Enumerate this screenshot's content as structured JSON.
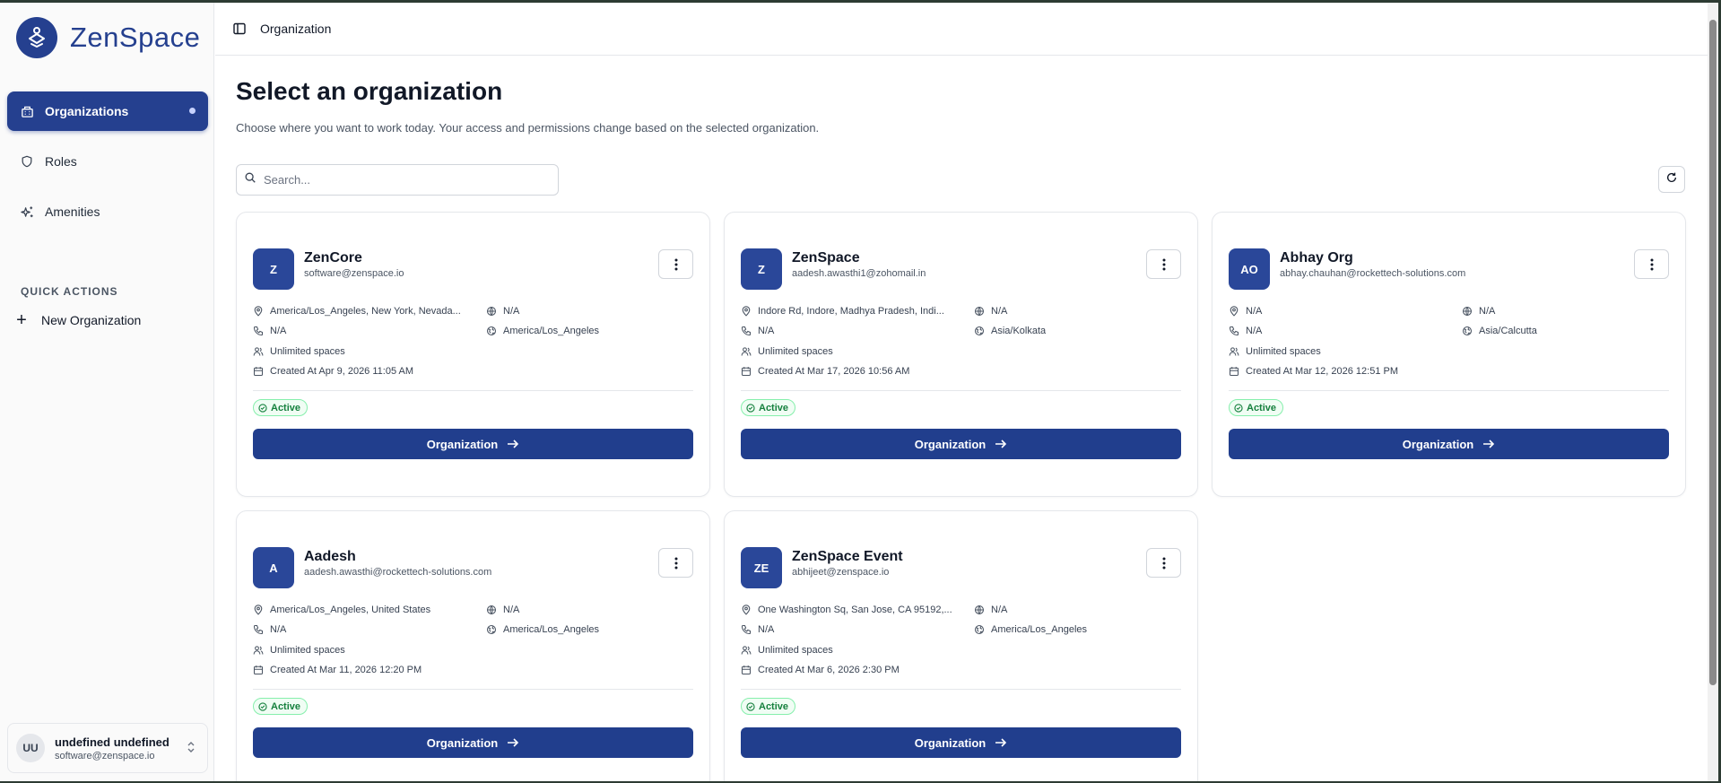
{
  "app": {
    "name": "ZenSpace"
  },
  "colors": {
    "brand": "#25408f",
    "active_green": "#15803d"
  },
  "sidebar": {
    "items": [
      {
        "label": "Organizations",
        "icon": "building-icon",
        "active": true
      },
      {
        "label": "Roles",
        "icon": "shield-icon",
        "active": false
      },
      {
        "label": "Amenities",
        "icon": "sparkles-icon",
        "active": false
      }
    ],
    "quick_actions_title": "QUICK ACTIONS",
    "quick_actions": [
      {
        "label": "New Organization",
        "icon": "plus-icon"
      }
    ],
    "user": {
      "initials": "UU",
      "name": "undefined undefined",
      "email": "software@zenspace.io"
    }
  },
  "header": {
    "breadcrumb": "Organization"
  },
  "main": {
    "title": "Select an organization",
    "subtitle": "Choose where you want to work today. Your access and permissions change based on the selected organization.",
    "search": {
      "placeholder": "Search...",
      "value": ""
    },
    "organizations": [
      {
        "initials": "Z",
        "name": "ZenCore",
        "email": "software@zenspace.io",
        "address": "America/Los_Angeles, New York, Nevada...",
        "website": "N/A",
        "phone": "N/A",
        "timezone": "America/Los_Angeles",
        "spaces": "Unlimited spaces",
        "created": "Created At Apr 9, 2026 11:05 AM",
        "status": "Active",
        "button": "Organization"
      },
      {
        "initials": "Z",
        "name": "ZenSpace",
        "email": "aadesh.awasthi1@zohomail.in",
        "address": "Indore Rd, Indore, Madhya Pradesh, Indi...",
        "website": "N/A",
        "phone": "N/A",
        "timezone": "Asia/Kolkata",
        "spaces": "Unlimited spaces",
        "created": "Created At Mar 17, 2026 10:56 AM",
        "status": "Active",
        "button": "Organization"
      },
      {
        "initials": "AO",
        "name": "Abhay Org",
        "email": "abhay.chauhan@rockettech-solutions.com",
        "address": "N/A",
        "website": "N/A",
        "phone": "N/A",
        "timezone": "Asia/Calcutta",
        "spaces": "Unlimited spaces",
        "created": "Created At Mar 12, 2026 12:51 PM",
        "status": "Active",
        "button": "Organization"
      },
      {
        "initials": "A",
        "name": "Aadesh",
        "email": "aadesh.awasthi@rockettech-solutions.com",
        "address": "America/Los_Angeles, United States",
        "website": "N/A",
        "phone": "N/A",
        "timezone": "America/Los_Angeles",
        "spaces": "Unlimited spaces",
        "created": "Created At Mar 11, 2026 12:20 PM",
        "status": "Active",
        "button": "Organization"
      },
      {
        "initials": "ZE",
        "name": "ZenSpace Event",
        "email": "abhijeet@zenspace.io",
        "address": "One Washington Sq, San Jose, CA 95192,...",
        "website": "N/A",
        "phone": "N/A",
        "timezone": "America/Los_Angeles",
        "spaces": "Unlimited spaces",
        "created": "Created At Mar 6, 2026 2:30 PM",
        "status": "Active",
        "button": "Organization"
      }
    ]
  }
}
